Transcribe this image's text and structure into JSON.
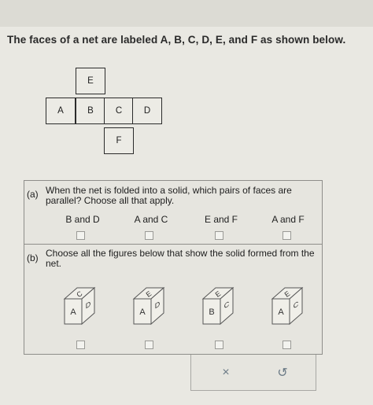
{
  "intro_text": "The faces of a net are labeled A, B, C, D, E, and F as shown below.",
  "net": {
    "faces": [
      "E",
      "A",
      "B",
      "C",
      "D",
      "F"
    ]
  },
  "part_a": {
    "label": "(a)",
    "question": "When the net is folded into a solid, which pairs of faces are parallel? Choose all that apply.",
    "options": [
      "B and D",
      "A and C",
      "E and F",
      "A and F"
    ]
  },
  "part_b": {
    "label": "(b)",
    "question": "Choose all the figures below that show the solid formed from the net.",
    "figures": [
      {
        "top": "C",
        "front": "A",
        "side": "D"
      },
      {
        "top": "E",
        "front": "A",
        "side": "D"
      },
      {
        "top": "E",
        "front": "B",
        "side": "C"
      },
      {
        "top": "E",
        "front": "A",
        "side": "C"
      }
    ]
  },
  "actions": {
    "clear": "×",
    "undo": "↺"
  }
}
